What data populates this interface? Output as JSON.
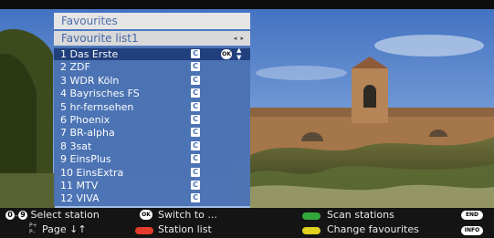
{
  "menu": {
    "title": "Favourites",
    "list_name": "Favourite list1",
    "list_arrows": "◂ ▸",
    "badge_label": "C",
    "ok_label": "OK",
    "updown_label": "▲▼",
    "channels": [
      {
        "label": "1 Das Erste",
        "selected": true
      },
      {
        "label": "2 ZDF"
      },
      {
        "label": "3 WDR Köln"
      },
      {
        "label": "4 Bayrisches FS"
      },
      {
        "label": "5 hr-fernsehen"
      },
      {
        "label": "6 Phoenix"
      },
      {
        "label": "7 BR-alpha"
      },
      {
        "label": "8 3sat"
      },
      {
        "label": "9 EinsPlus"
      },
      {
        "label": "10 EinsExtra"
      },
      {
        "label": "11 MTV"
      },
      {
        "label": "12 VIVA"
      }
    ]
  },
  "footer": {
    "key_0": "0",
    "key_9": "9",
    "select_station": "Select station",
    "page_key_plus": "P+",
    "page_key_minus": "P–",
    "page": "Page ↓↑",
    "ok_key": "OK",
    "switch_to": "Switch to ...",
    "station_list": "Station list",
    "scan_stations": "Scan stations",
    "change_favourites": "Change favourites",
    "end_key": "END",
    "info_key": "INFO"
  },
  "colors": {
    "panel_blue": "#4b72b3",
    "selected_blue": "#203d7a",
    "red_key": "#e23b2c",
    "green_key": "#33a83a",
    "yellow_key": "#e0d020"
  }
}
